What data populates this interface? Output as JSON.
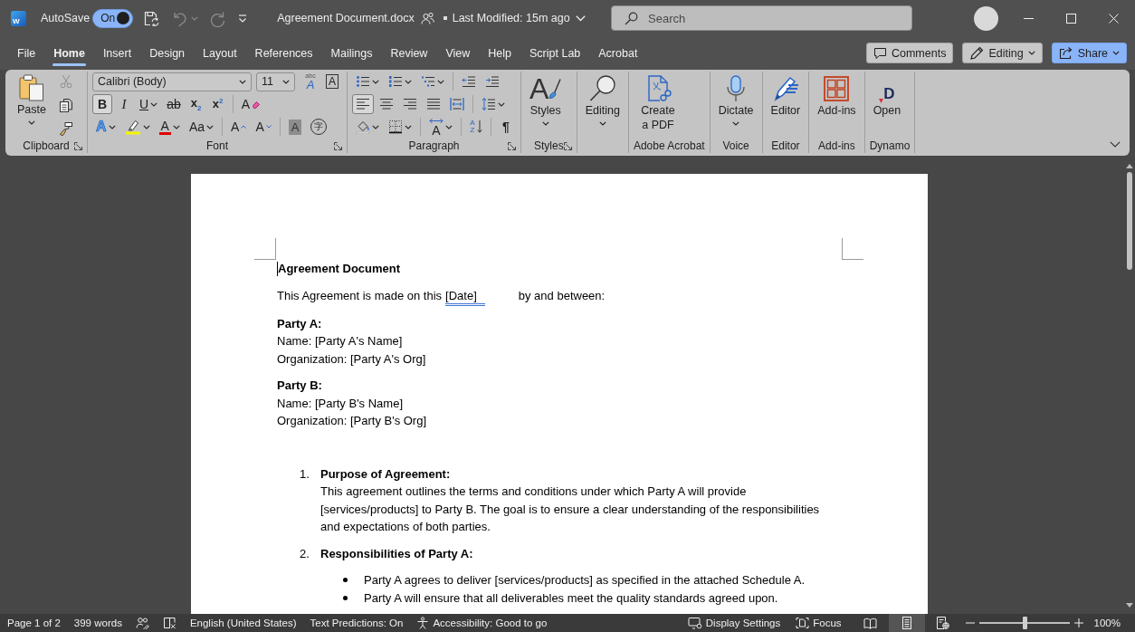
{
  "title_bar": {
    "logo_glyph": "W",
    "autosave": {
      "label": "AutoSave",
      "state_label": "On",
      "on": true
    },
    "quick_access": [
      {
        "kind": "save",
        "disabled": false,
        "dropdown": false
      },
      {
        "kind": "undo",
        "disabled": true,
        "dropdown": true
      },
      {
        "kind": "redo",
        "disabled": true,
        "dropdown": false
      },
      {
        "kind": "customize",
        "disabled": false,
        "dropdown": false
      }
    ],
    "document_title": "Agreement Document.docx",
    "last_modified": "Last Modified: 15m ago",
    "search": {
      "placeholder": "Search"
    }
  },
  "menu_tabs": [
    {
      "label": "File",
      "selected": false
    },
    {
      "label": "Home",
      "selected": true
    },
    {
      "label": "Insert",
      "selected": false
    },
    {
      "label": "Design",
      "selected": false
    },
    {
      "label": "Layout",
      "selected": false
    },
    {
      "label": "References",
      "selected": false
    },
    {
      "label": "Mailings",
      "selected": false
    },
    {
      "label": "Review",
      "selected": false
    },
    {
      "label": "View",
      "selected": false
    },
    {
      "label": "Help",
      "selected": false
    },
    {
      "label": "Script Lab",
      "selected": false
    },
    {
      "label": "Acrobat",
      "selected": false
    }
  ],
  "header_buttons": [
    {
      "kind": "comments",
      "label": "Comments",
      "dropdown": false
    },
    {
      "kind": "editing",
      "label": "Editing",
      "dropdown": true
    },
    {
      "kind": "share",
      "label": "Share",
      "dropdown": true
    }
  ],
  "ribbon": {
    "groups": [
      {
        "kind": "clipboard",
        "label": "Clipboard",
        "launcher": true,
        "paste": {
          "label": "Paste",
          "dropdown": true
        },
        "tools": [
          {
            "kind": "cut",
            "disabled": true
          },
          {
            "kind": "copy",
            "disabled": false
          },
          {
            "kind": "format-painter",
            "disabled": false
          }
        ]
      },
      {
        "kind": "font",
        "label": "Font",
        "launcher": true,
        "font_name": "Calibri (Body)",
        "font_size": "11",
        "rows": [
          [
            [
              {
                "kind": "phonetic-guide",
                "glyphs": [
                  "abc",
                  "A"
                ],
                "selected": false,
                "dropdown": false
              },
              {
                "kind": "character-border",
                "glyph": "A",
                "selected": false,
                "dropdown": false
              }
            ]
          ],
          [
            [
              {
                "kind": "bold",
                "glyph": "B",
                "selected": true,
                "dropdown": false
              },
              {
                "kind": "italic",
                "glyph": "I",
                "selected": false,
                "dropdown": false
              },
              {
                "kind": "underline",
                "glyph": "U",
                "selected": false,
                "dropdown": true
              },
              {
                "kind": "strikethrough",
                "glyph": "ab",
                "selected": false,
                "dropdown": false
              },
              {
                "kind": "subscript",
                "glyph": "x$_{2}$",
                "selected": false,
                "dropdown": false
              },
              {
                "kind": "superscript",
                "glyph": "x$^{2}$",
                "selected": false,
                "dropdown": false
              }
            ],
            [
              {
                "kind": "clear-formatting",
                "glyph": "A",
                "selected": false,
                "dropdown": false
              }
            ]
          ],
          [
            [
              {
                "kind": "text-effects",
                "glyph": "A",
                "selected": false,
                "dropdown": true
              },
              {
                "kind": "highlight",
                "selected": false,
                "dropdown": true
              },
              {
                "kind": "font-color",
                "glyph": "A",
                "selected": false,
                "dropdown": true
              },
              {
                "kind": "change-case",
                "glyph": "Aa",
                "selected": false,
                "dropdown": true
              }
            ],
            [
              {
                "kind": "grow-font",
                "glyph": "A",
                "selected": false,
                "dropdown": false
              },
              {
                "kind": "shrink-font",
                "glyph": "A",
                "selected": false,
                "dropdown": false
              }
            ],
            [
              {
                "kind": "character-shading",
                "glyph": "A",
                "selected": false,
                "dropdown": false
              },
              {
                "kind": "enclose-characters",
                "glyph": "字",
                "selected": false,
                "dropdown": false
              }
            ]
          ]
        ]
      },
      {
        "kind": "paragraph",
        "label": "Paragraph",
        "launcher": true,
        "rows": [
          [
            [
              {
                "kind": "bullets",
                "selected": false,
                "dropdown": true
              },
              {
                "kind": "numbering",
                "selected": false,
                "dropdown": true
              },
              {
                "kind": "multilevel-list",
                "selected": false,
                "dropdown": true
              }
            ],
            [
              {
                "kind": "decrease-indent",
                "selected": false,
                "dropdown": false
              },
              {
                "kind": "increase-indent",
                "selected": false,
                "dropdown": false
              }
            ]
          ],
          [
            [
              {
                "kind": "align-left",
                "selected": true,
                "dropdown": false
              },
              {
                "kind": "center",
                "selected": false,
                "dropdown": false
              },
              {
                "kind": "align-right",
                "selected": false,
                "dropdown": false
              },
              {
                "kind": "justify",
                "selected": false,
                "dropdown": false
              },
              {
                "kind": "distributed",
                "selected": false,
                "dropdown": false
              }
            ],
            [
              {
                "kind": "line-spacing",
                "selected": false,
                "dropdown": true
              }
            ]
          ],
          [
            [
              {
                "kind": "shading",
                "selected": false,
                "dropdown": true
              },
              {
                "kind": "borders",
                "selected": false,
                "dropdown": true
              }
            ],
            [
              {
                "kind": "text-direction",
                "glyph": "A",
                "selected": false,
                "dropdown": true
              }
            ],
            [
              {
                "kind": "sort",
                "glyphs": [
                  "A",
                  "Z"
                ],
                "selected": false,
                "dropdown": false
              }
            ],
            [
              {
                "kind": "show-marks",
                "glyph": "¶",
                "selected": false,
                "dropdown": false
              }
            ]
          ]
        ]
      },
      {
        "kind": "buttons",
        "label": "Styles",
        "launcher": true,
        "buttons": [
          {
            "kind": "styles",
            "label": "Styles",
            "glyph": "A",
            "dropdown": true
          }
        ]
      },
      {
        "kind": "buttons",
        "buttons": [
          {
            "kind": "find",
            "label": "Editing",
            "dropdown": true
          }
        ]
      },
      {
        "kind": "buttons",
        "label": "Adobe Acrobat",
        "buttons": [
          {
            "kind": "pdf",
            "label": "Create a PDF",
            "dropdown": false
          }
        ]
      },
      {
        "kind": "buttons",
        "label": "Voice",
        "buttons": [
          {
            "kind": "dictate",
            "label": "Dictate",
            "dropdown": true
          }
        ]
      },
      {
        "kind": "buttons",
        "label": "Editor",
        "buttons": [
          {
            "kind": "editor",
            "label": "Editor",
            "dropdown": false
          }
        ]
      },
      {
        "kind": "buttons",
        "label": "Add-ins",
        "buttons": [
          {
            "kind": "add-ins",
            "label": "Add-ins",
            "dropdown": false
          }
        ]
      },
      {
        "kind": "buttons",
        "label": "Dynamo",
        "buttons": [
          {
            "kind": "logo",
            "label": "Open",
            "glyph": "D",
            "dropdown": false
          }
        ]
      }
    ]
  },
  "document": {
    "heading": "Agreement Document",
    "intro": {
      "before": "This Agreement is made on this",
      "field": "[Date]",
      "after": "by and between:"
    },
    "parties": [
      {
        "title": "Party A:",
        "lines": [
          "Name: [Party A's Name]",
          "Organization: [Party A's Org]"
        ]
      },
      {
        "title": "Party B:",
        "lines": [
          "Name: [Party B's Name]",
          "Organization: [Party B's Org]"
        ]
      }
    ],
    "sections": [
      {
        "number": "1.",
        "title": "Purpose of Agreement:",
        "body": "This agreement outlines the terms and conditions under which Party A will provide [services/products] to Party B. The goal is to ensure a clear understanding of the responsibilities and expectations of both parties."
      },
      {
        "number": "2.",
        "title": "Responsibilities of Party A:",
        "bullets": [
          "Party A agrees to deliver [services/products] as specified in the attached Schedule A.",
          "Party A will ensure that all deliverables meet the quality standards agreed upon."
        ]
      }
    ]
  },
  "status_bar": {
    "page": "Page 1 of 2",
    "word_count": "399 words",
    "language": "English (United States)",
    "text_predictions": "Text Predictions: On",
    "accessibility": "Accessibility: Good to go",
    "display_settings": "Display Settings",
    "focus": "Focus",
    "views": [
      {
        "kind": "read-mode",
        "selected": false
      },
      {
        "kind": "print-layout",
        "selected": true
      },
      {
        "kind": "web-layout",
        "selected": false
      }
    ],
    "zoom": {
      "level": 0.5,
      "label": "100%"
    }
  }
}
